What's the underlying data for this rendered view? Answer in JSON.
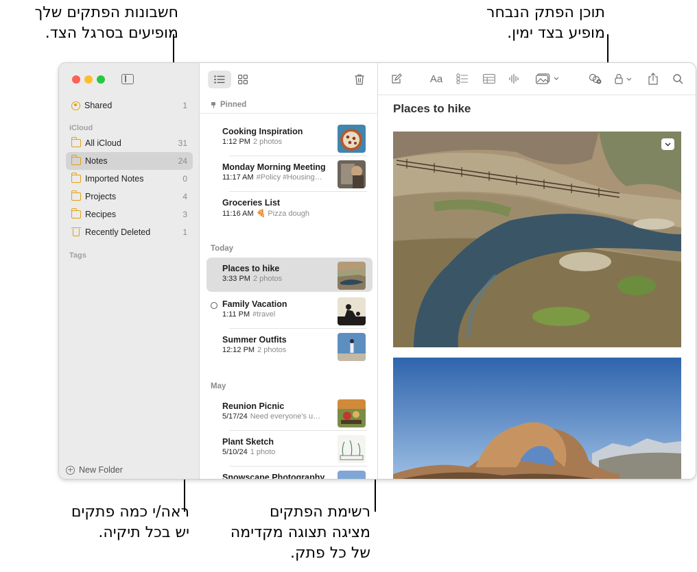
{
  "callouts": {
    "top_left": [
      "חשבונות הפתקים שלך",
      "מופיעים בסרגל הצד."
    ],
    "top_right": [
      "תוכן הפתק הנבחר",
      "מופיע בצד ימין."
    ],
    "bottom_left": [
      "ראה/י כמה פתקים",
      "יש בכל תיקיה."
    ],
    "bottom_middle": [
      "רשימת הפתקים",
      "מציגה תצוגה מקדימה",
      "של כל פתק."
    ]
  },
  "sidebar": {
    "shared": {
      "label": "Shared",
      "count": "1",
      "icon": "shared-icon"
    },
    "section_icloud": "iCloud",
    "folders": [
      {
        "label": "All iCloud",
        "count": "31",
        "icon": "folder-icon"
      },
      {
        "label": "Notes",
        "count": "24",
        "icon": "folder-icon",
        "selected": true
      },
      {
        "label": "Imported Notes",
        "count": "0",
        "icon": "folder-icon"
      },
      {
        "label": "Projects",
        "count": "4",
        "icon": "folder-icon"
      },
      {
        "label": "Recipes",
        "count": "3",
        "icon": "folder-icon"
      },
      {
        "label": "Recently Deleted",
        "count": "1",
        "icon": "trash-icon"
      }
    ],
    "section_tags": "Tags",
    "new_folder": "New Folder"
  },
  "list": {
    "section_pinned": "Pinned",
    "section_today": "Today",
    "section_may": "May",
    "pinned": [
      {
        "title": "Cooking Inspiration",
        "time": "1:12 PM",
        "preview": "2 photos"
      },
      {
        "title": "Monday Morning Meeting",
        "time": "11:17 AM",
        "preview": "#Policy #Housing…"
      },
      {
        "title": "Groceries List",
        "time": "11:16 AM",
        "preview": "🍕 Pizza dough"
      }
    ],
    "today": [
      {
        "title": "Places to hike",
        "time": "3:33 PM",
        "preview": "2 photos",
        "selected": true
      },
      {
        "title": "Family Vacation",
        "time": "1:11 PM",
        "preview": "#travel",
        "shared": true
      },
      {
        "title": "Summer Outfits",
        "time": "12:12 PM",
        "preview": "2 photos"
      }
    ],
    "may": [
      {
        "title": "Reunion Picnic",
        "time": "5/17/24",
        "preview": "Need everyone's u…"
      },
      {
        "title": "Plant Sketch",
        "time": "5/10/24",
        "preview": "1 photo"
      },
      {
        "title": "Snowscape Photography",
        "time": "",
        "preview": ""
      }
    ]
  },
  "editor": {
    "format_label": "Aa",
    "note_title": "Places to hike"
  },
  "colors": {
    "accent": "#e2a10e",
    "selection": "#d4d4d4",
    "sidebar_bg": "#ebebeb"
  }
}
